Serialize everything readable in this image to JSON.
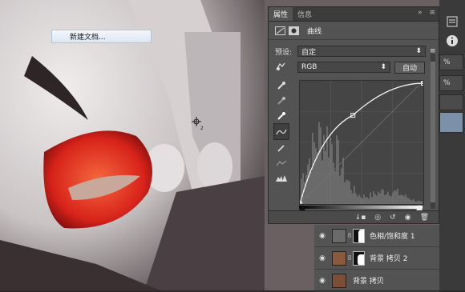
{
  "context_menu": {
    "item": "新建文档..."
  },
  "properties": {
    "tabs": [
      "属性",
      "信息"
    ],
    "title": "曲线",
    "preset_label": "预设:",
    "preset_value": "自定",
    "channel_value": "RGB",
    "auto_button": "自动"
  },
  "curve": {
    "points": [
      [
        0,
        0
      ],
      [
        0.43,
        0.72
      ],
      [
        1,
        0.98
      ]
    ]
  },
  "right_strip": {
    "values": [
      "%",
      "%"
    ]
  },
  "layers": [
    {
      "name": "色相/饱和度 1",
      "type": "adjustment"
    },
    {
      "name": "背景 拷贝 2",
      "type": "image"
    },
    {
      "name": "背景 拷贝",
      "type": "image"
    }
  ]
}
